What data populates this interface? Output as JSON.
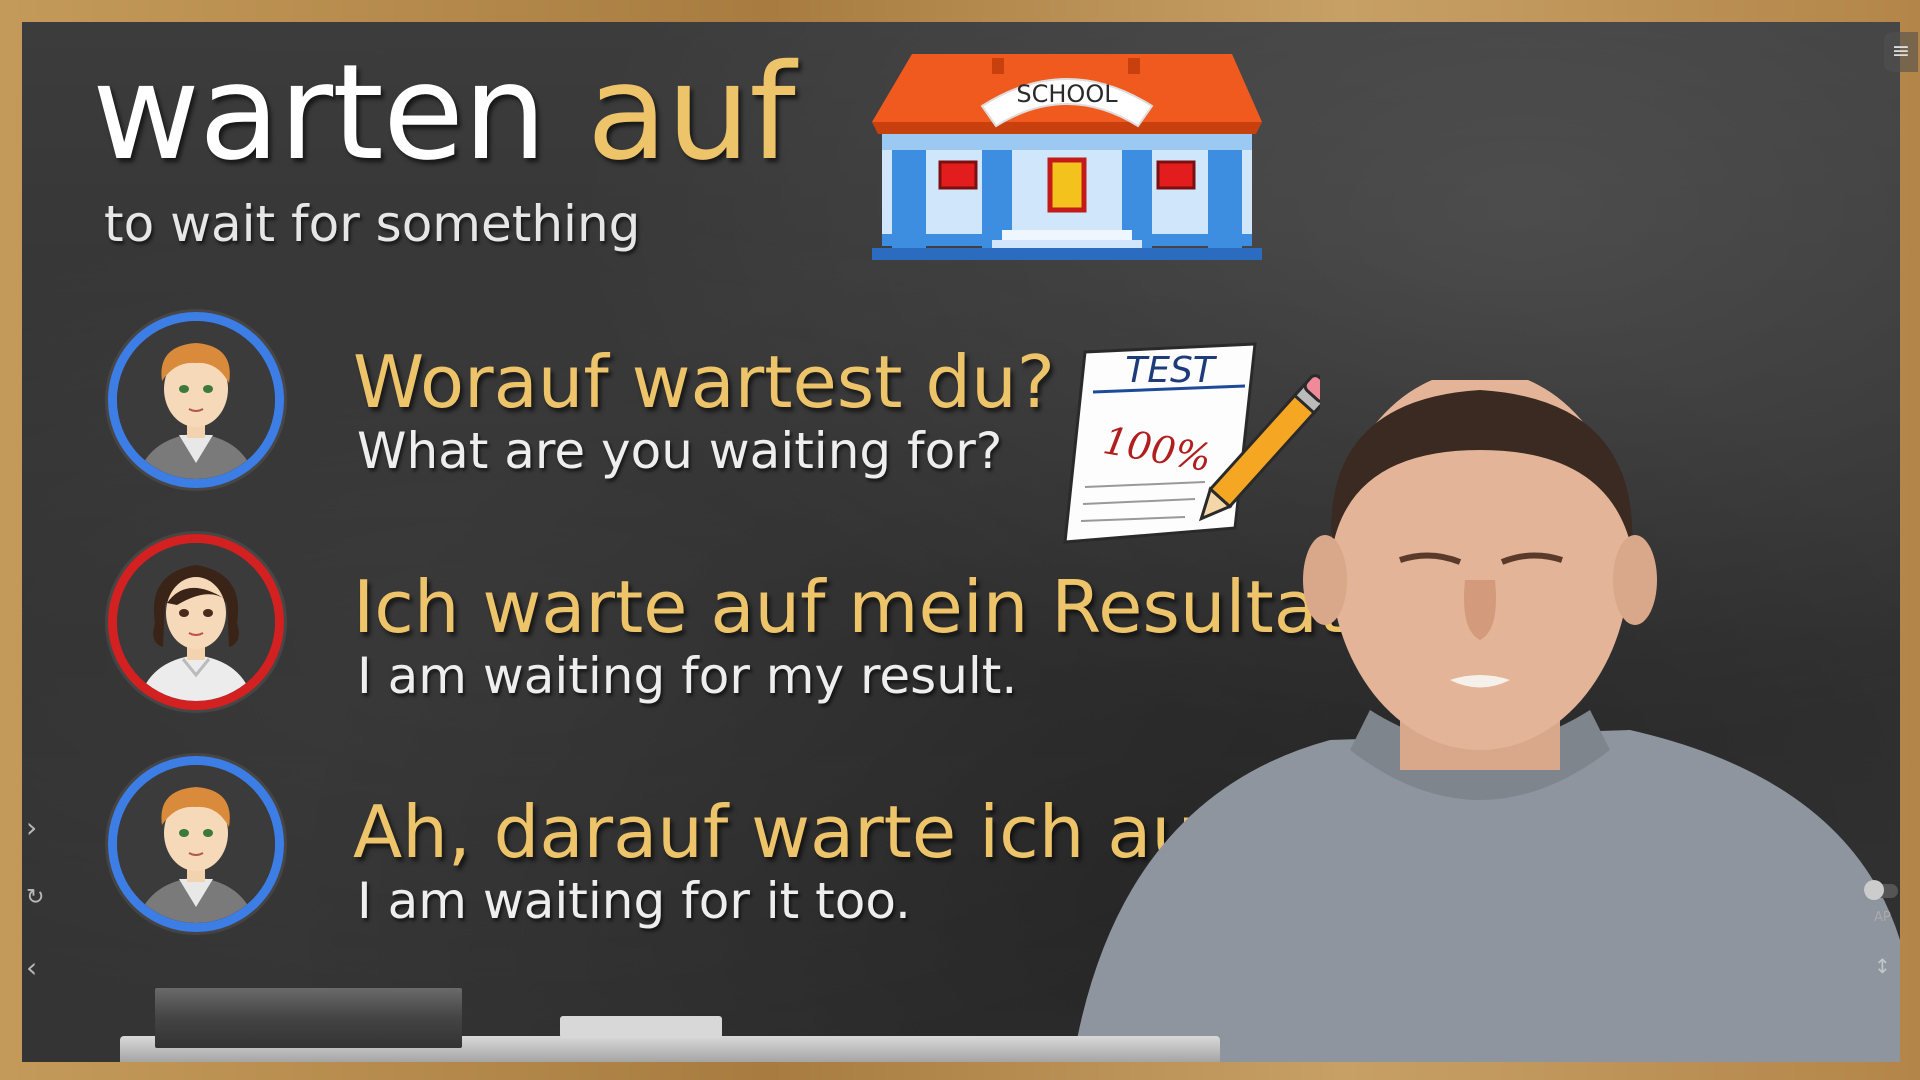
{
  "slide": {
    "title_word": "warten",
    "title_preposition": "auf",
    "subtitle": "to wait for something"
  },
  "images": {
    "school_sign": "SCHOOL",
    "test_title": "TEST",
    "test_score": "100%"
  },
  "dialogue": [
    {
      "speaker": "boy",
      "german": "Worauf wartest du?",
      "english": "What are you waiting for?"
    },
    {
      "speaker": "girl",
      "german": "Ich warte auf mein Resultat.",
      "english": "I am waiting for my result."
    },
    {
      "speaker": "boy",
      "german": "Ah, darauf warte ich auch.",
      "english": "I am waiting for it too."
    }
  ],
  "controls": {
    "menu_icon": "menu-icon",
    "next_icon": "chevron-right-icon",
    "replay_icon": "replay-icon",
    "prev_icon": "chevron-left-icon",
    "autoplay_label": "AP",
    "expand_icon": "expand-icon"
  },
  "colors": {
    "accent_yellow": "#edc46a",
    "boy_ring": "#3d7ee6",
    "girl_ring": "#d32020"
  }
}
